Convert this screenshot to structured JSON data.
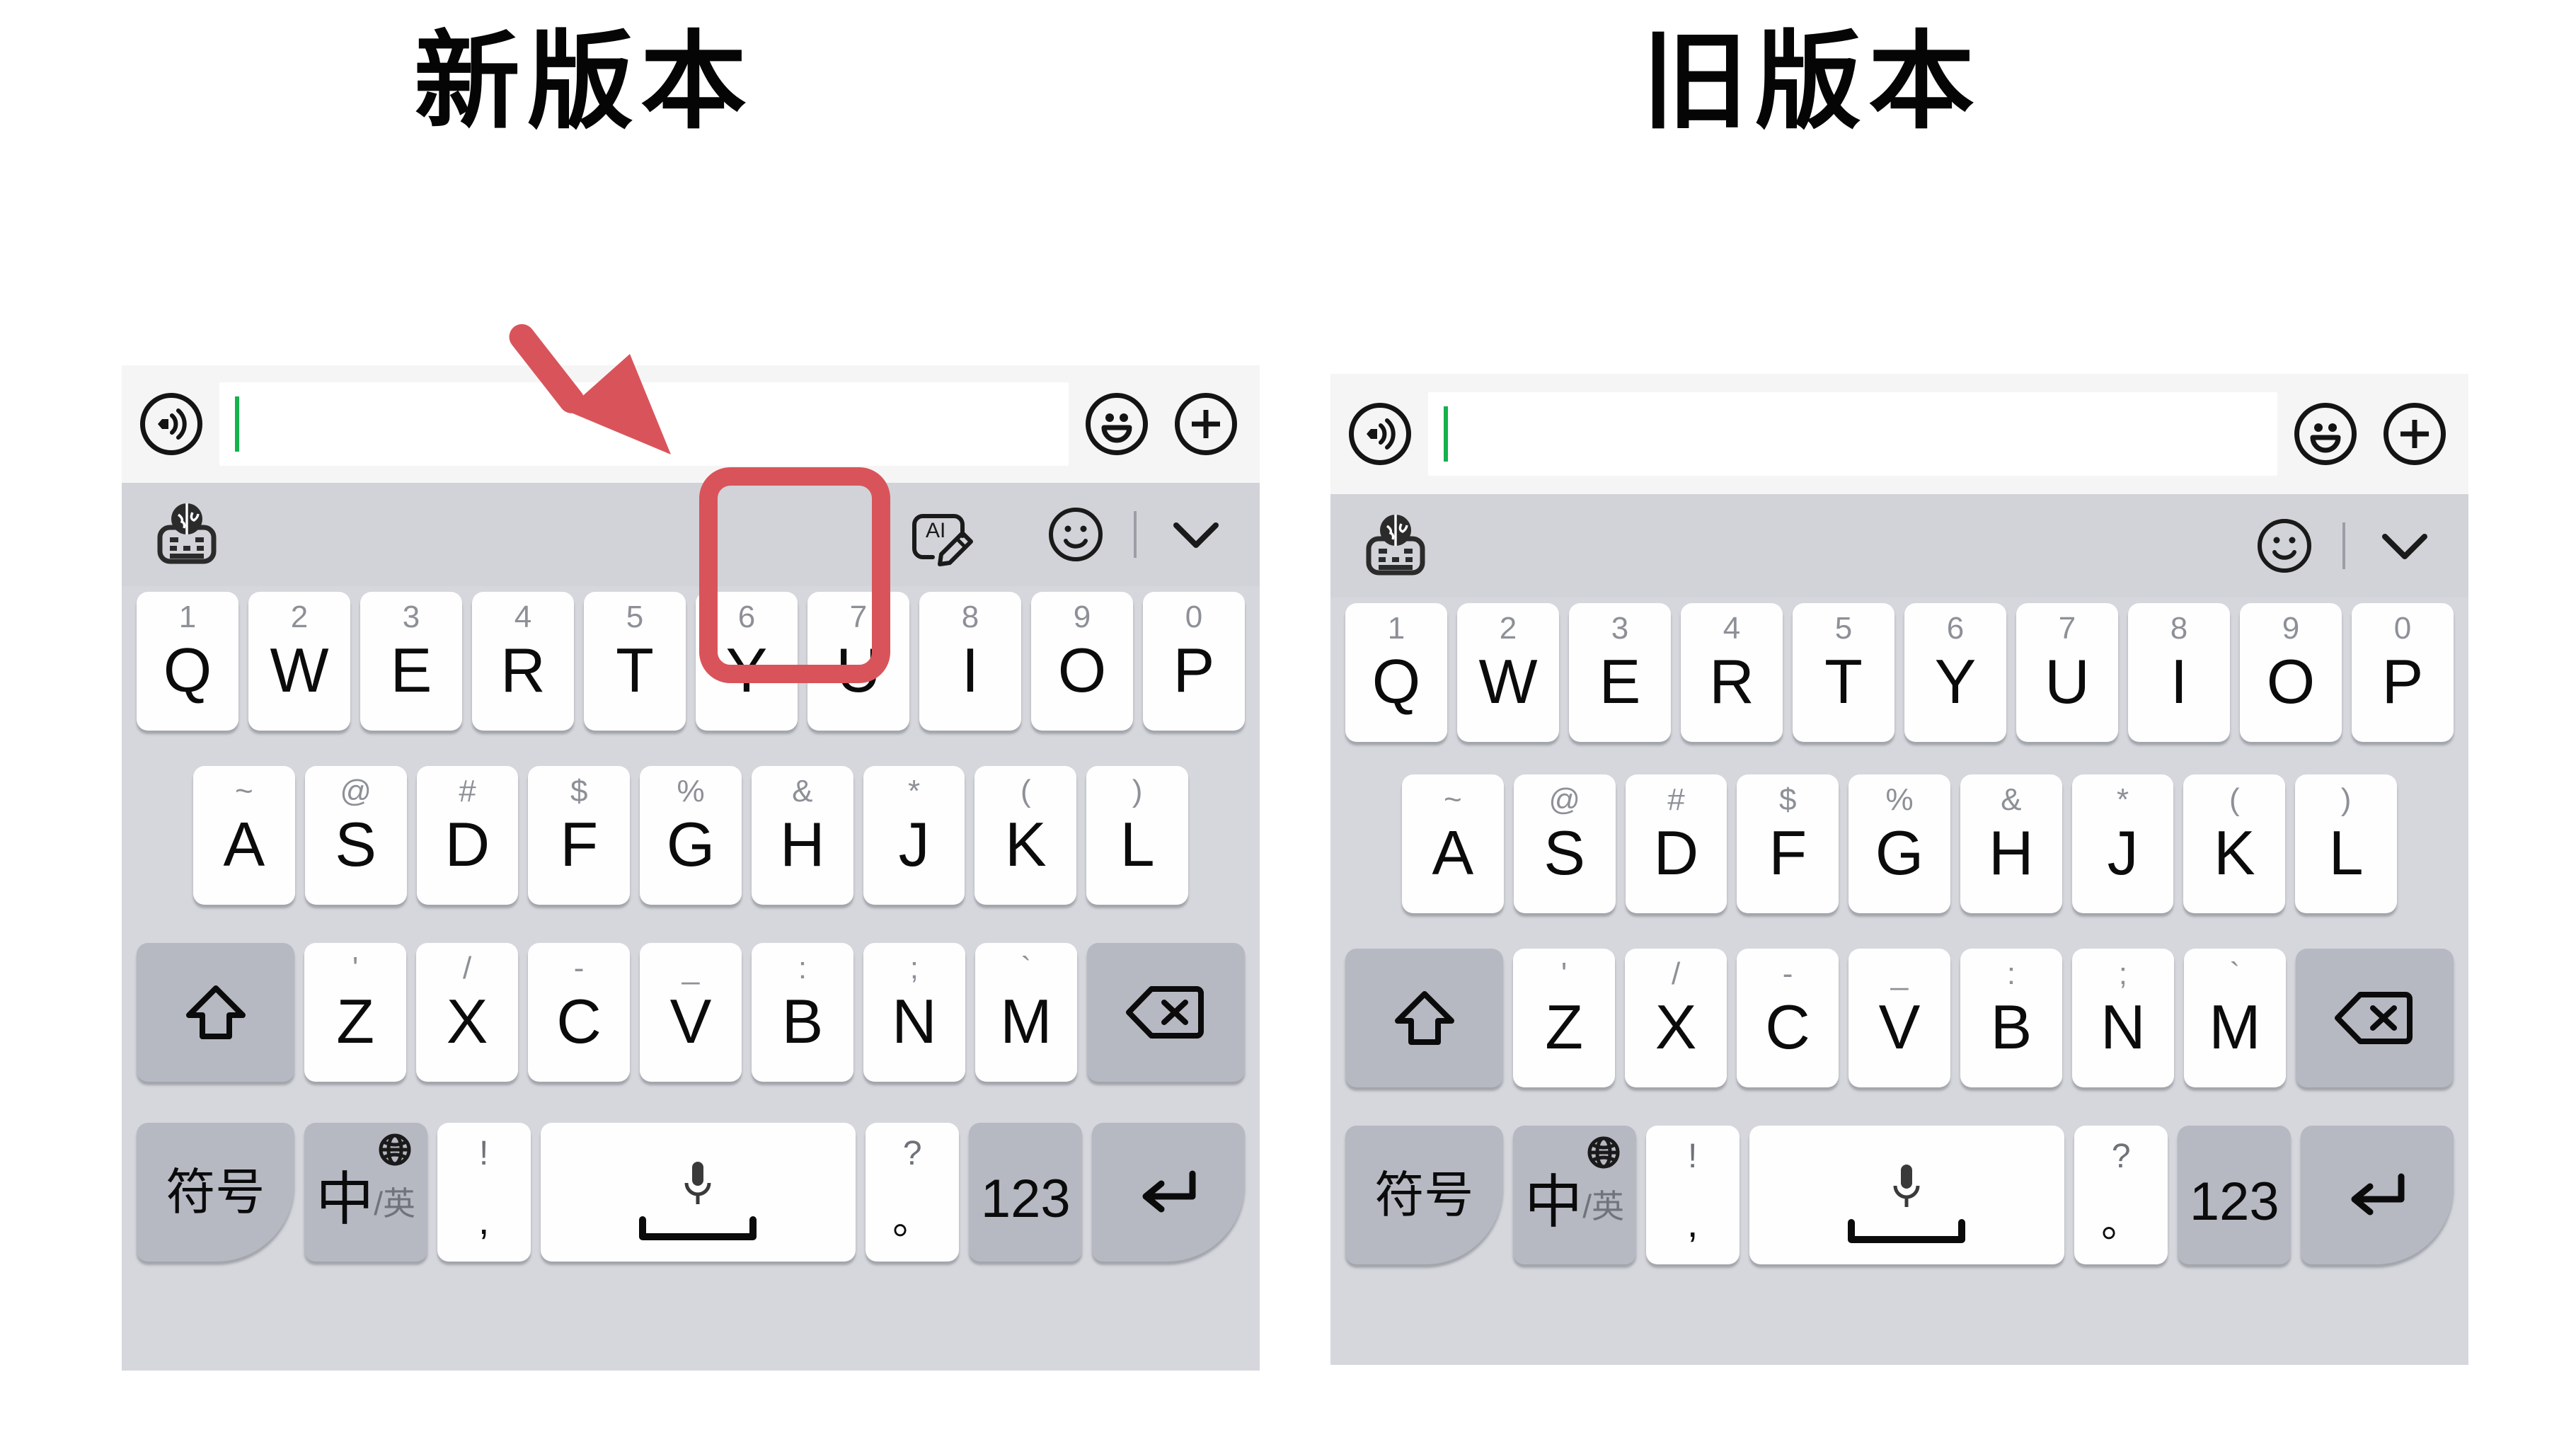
{
  "headings": {
    "new_version": "新版本",
    "old_version": "旧版本"
  },
  "colors": {
    "annotation_red": "#d9545a",
    "caret_green": "#14b24b",
    "keyboard_bg": "#d1d3d8",
    "key_white": "#fefefe",
    "key_gray": "#b6b9c2",
    "inputbar_bg": "#f5f5f6"
  },
  "panels": [
    {
      "id": "new",
      "heading": "新版本",
      "input_bar": {
        "voice_icon": "voice-wave-icon",
        "text_value": "",
        "emoji_icon": "smiley-face-icon",
        "add_icon": "plus-circle-icon"
      },
      "toolbar": {
        "left_icon": "globe-keyboard-icon",
        "ai_icon": "ai-edit-icon",
        "ai_icon_label": "AI",
        "emoji_icon": "smiley-outline-icon",
        "collapse_icon": "chevron-down-icon",
        "has_ai_button": true
      }
    },
    {
      "id": "old",
      "heading": "旧版本",
      "input_bar": {
        "voice_icon": "voice-wave-icon",
        "text_value": "",
        "emoji_icon": "smiley-face-icon",
        "add_icon": "plus-circle-icon"
      },
      "toolbar": {
        "left_icon": "globe-keyboard-icon",
        "emoji_icon": "smiley-outline-icon",
        "collapse_icon": "chevron-down-icon",
        "has_ai_button": false
      }
    }
  ],
  "keyboard": {
    "row1": [
      {
        "main": "Q",
        "sup": "1"
      },
      {
        "main": "W",
        "sup": "2"
      },
      {
        "main": "E",
        "sup": "3"
      },
      {
        "main": "R",
        "sup": "4"
      },
      {
        "main": "T",
        "sup": "5"
      },
      {
        "main": "Y",
        "sup": "6"
      },
      {
        "main": "U",
        "sup": "7"
      },
      {
        "main": "I",
        "sup": "8"
      },
      {
        "main": "O",
        "sup": "9"
      },
      {
        "main": "P",
        "sup": "0"
      }
    ],
    "row2": [
      {
        "main": "A",
        "sup": "~"
      },
      {
        "main": "S",
        "sup": "@"
      },
      {
        "main": "D",
        "sup": "#"
      },
      {
        "main": "F",
        "sup": "$"
      },
      {
        "main": "G",
        "sup": "%"
      },
      {
        "main": "H",
        "sup": "&"
      },
      {
        "main": "J",
        "sup": "*"
      },
      {
        "main": "K",
        "sup": "("
      },
      {
        "main": "L",
        "sup": ")"
      }
    ],
    "row3": {
      "shift_icon": "shift-arrow-icon",
      "keys": [
        {
          "main": "Z",
          "sup": "'"
        },
        {
          "main": "X",
          "sup": "/"
        },
        {
          "main": "C",
          "sup": "-"
        },
        {
          "main": "V",
          "sup": "_"
        },
        {
          "main": "B",
          "sup": ":"
        },
        {
          "main": "N",
          "sup": ";"
        },
        {
          "main": "M",
          "sup": "`"
        }
      ],
      "backspace_icon": "backspace-icon"
    },
    "row4": {
      "symbol_key": "符号",
      "lang_key_primary": "中",
      "lang_key_secondary": "/英",
      "lang_key_icon": "globe-icon",
      "comma_top": "!",
      "comma_bottom": ",",
      "space_icon": "microphone-icon",
      "space_bar_icon": "spacebar-icon",
      "period_top": "?",
      "period_bottom": "。",
      "numeric_key": "123",
      "enter_icon": "enter-return-icon"
    }
  },
  "annotations": {
    "arrow": "red-pointer-arrow",
    "highlight": "red-rounded-highlight-box"
  }
}
